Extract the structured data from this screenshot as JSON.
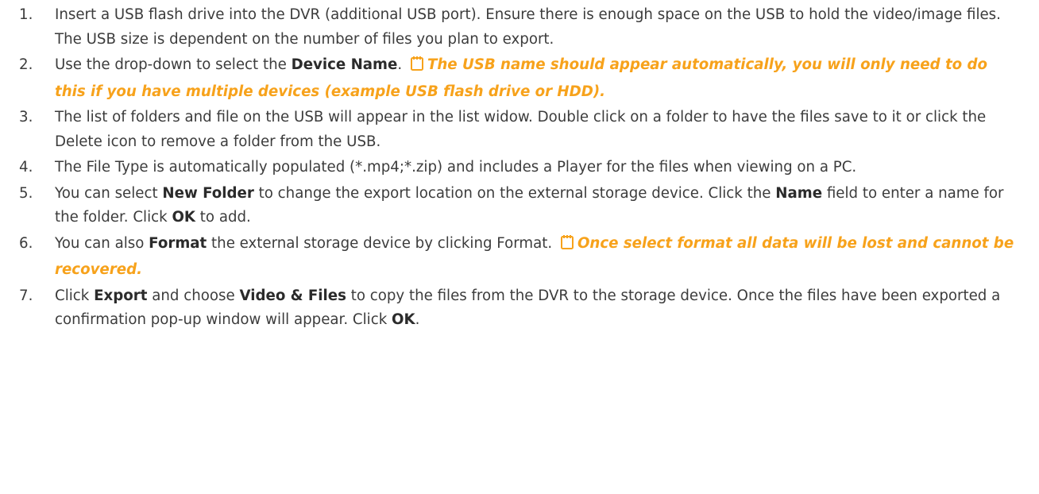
{
  "steps": [
    {
      "num": "1.",
      "parts": [
        {
          "t": "text",
          "v": "Insert a USB flash drive into the DVR (additional USB port). Ensure there is enough space on the USB to hold the video/image files. The USB size is dependent on the number of files you plan to export."
        }
      ]
    },
    {
      "num": "2.",
      "parts": [
        {
          "t": "text",
          "v": "Use the drop-down to select the "
        },
        {
          "t": "bold",
          "v": "Device Name"
        },
        {
          "t": "text",
          "v": ". "
        },
        {
          "t": "icon",
          "v": "note-icon"
        },
        {
          "t": "note",
          "v": "The USB name should appear automatically, you will only need to do this if you have multiple devices (example USB flash drive or HDD)."
        }
      ]
    },
    {
      "num": "3.",
      "parts": [
        {
          "t": "text",
          "v": "The list of folders and file on the USB will appear in the list widow. Double click on a folder to have the files save to it or click the Delete icon to remove a folder from the USB."
        }
      ]
    },
    {
      "num": "4.",
      "parts": [
        {
          "t": "text",
          "v": "The File Type is automatically populated (*.mp4;*.zip) and includes a Player for the files when viewing on a PC."
        }
      ]
    },
    {
      "num": "5.",
      "parts": [
        {
          "t": "text",
          "v": "You can select "
        },
        {
          "t": "bold",
          "v": "New Folder"
        },
        {
          "t": "text",
          "v": " to change the export location on the external storage device. Click the "
        },
        {
          "t": "bold",
          "v": "Name"
        },
        {
          "t": "text",
          "v": " field to enter a name for the folder. Click "
        },
        {
          "t": "bold",
          "v": "OK"
        },
        {
          "t": "text",
          "v": " to add."
        }
      ]
    },
    {
      "num": "6.",
      "parts": [
        {
          "t": "text",
          "v": "You can also "
        },
        {
          "t": "bold",
          "v": "Format"
        },
        {
          "t": "text",
          "v": " the external storage device by clicking Format. "
        },
        {
          "t": "icon",
          "v": "note-icon"
        },
        {
          "t": "note",
          "v": "Once select format all data will be lost and cannot be recovered."
        }
      ]
    },
    {
      "num": "7.",
      "parts": [
        {
          "t": "text",
          "v": "Click "
        },
        {
          "t": "bold",
          "v": "Export"
        },
        {
          "t": "text",
          "v": " and choose "
        },
        {
          "t": "bold",
          "v": "Video & Files"
        },
        {
          "t": "text",
          "v": " to copy the files from the DVR to the storage device. Once the files have been exported a confirmation pop-up window will appear. Click "
        },
        {
          "t": "bold",
          "v": "OK"
        },
        {
          "t": "text",
          "v": "."
        }
      ]
    }
  ],
  "colors": {
    "text": "#3c3c3c",
    "note": "#f7a21b"
  }
}
